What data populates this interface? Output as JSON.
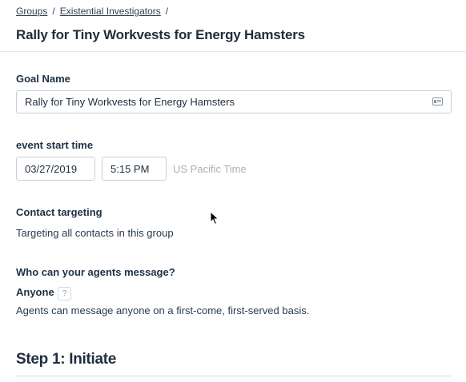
{
  "breadcrumb": {
    "items": [
      "Groups",
      "Existential Investigators"
    ],
    "separator": "/"
  },
  "page_title": "Rally for Tiny Workvests for Energy Hamsters",
  "goal_name": {
    "label": "Goal Name",
    "value": "Rally for Tiny Workvests for Energy Hamsters",
    "icon": "card-icon"
  },
  "event_start": {
    "label": "event start time",
    "date": "03/27/2019",
    "time": "5:15 PM",
    "timezone": "US Pacific Time"
  },
  "contact_targeting": {
    "label": "Contact targeting",
    "text": "Targeting all contacts in this group"
  },
  "agents_message": {
    "label": "Who can your agents message?",
    "option": "Anyone",
    "help": "?",
    "description": "Agents can message anyone on a first-come, first-served basis."
  },
  "step": {
    "title": "Step 1: Initiate"
  }
}
